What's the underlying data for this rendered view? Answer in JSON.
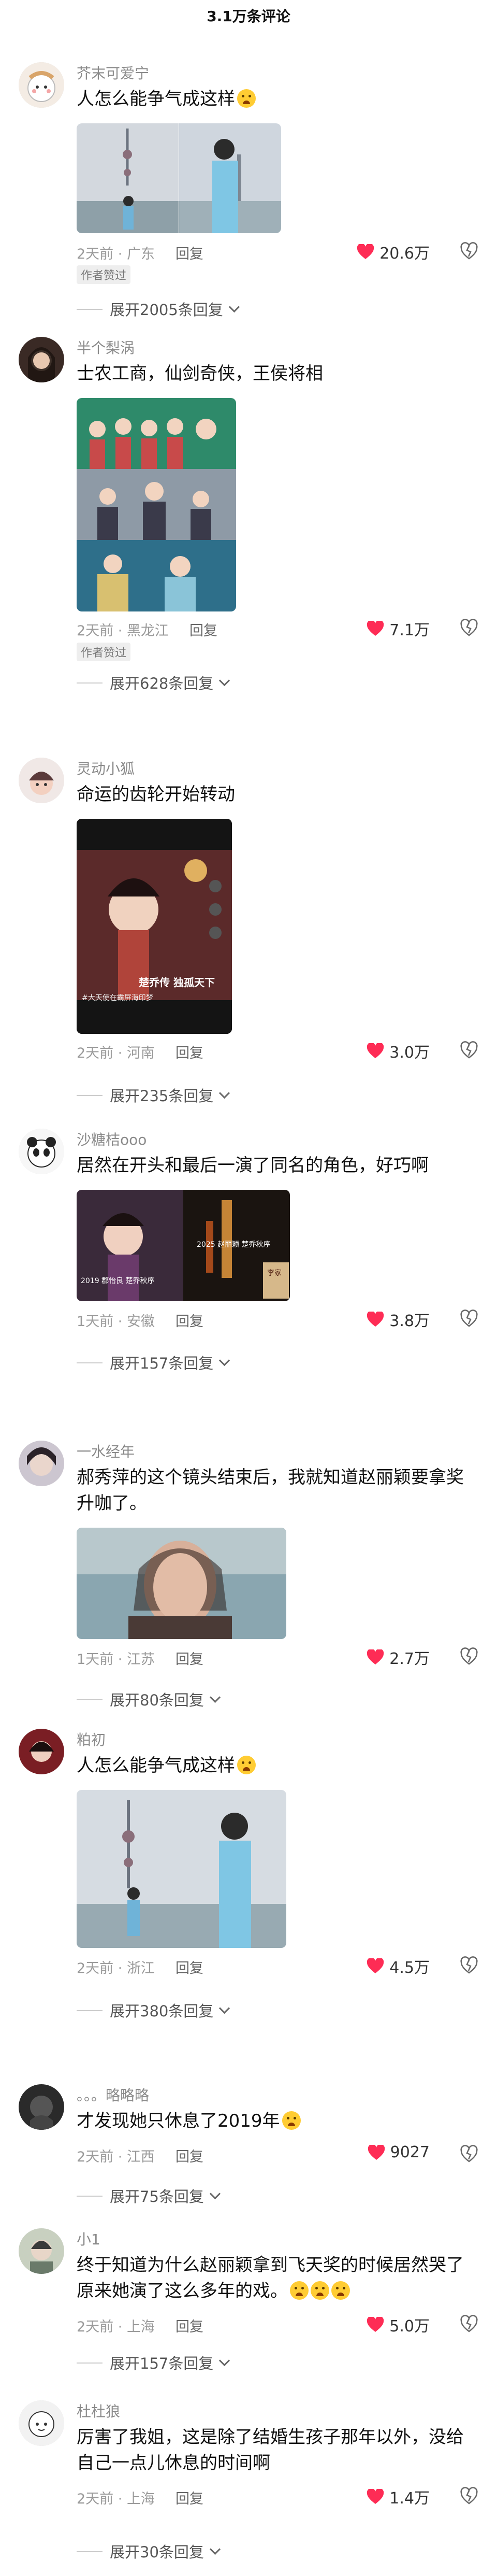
{
  "header": {
    "title": "3.1万条评论"
  },
  "comments": [
    {
      "user": "芥末可爱宁",
      "text": "人怎么能争气成这样",
      "emoji": true,
      "time": "2天前",
      "location": "广东",
      "reply": "回复",
      "likes": "20.6万",
      "badge": "作者赞过",
      "expand": "展开2005条回复"
    },
    {
      "user": "半个梨涡",
      "text": "士农工商，仙剑奇侠，王侯将相",
      "emoji": false,
      "time": "2天前",
      "location": "黑龙江",
      "reply": "回复",
      "likes": "7.1万",
      "badge": "作者赞过",
      "expand": "展开628条回复"
    },
    {
      "user": "灵动小狐",
      "text": "命运的齿轮开始转动",
      "emoji": false,
      "time": "2天前",
      "location": "河南",
      "reply": "回复",
      "likes": "3.0万",
      "badge": "",
      "expand": "展开235条回复"
    },
    {
      "user": "沙糖桔ooo",
      "text": "居然在开头和最后一演了同名的角色，好巧啊",
      "emoji": false,
      "time": "1天前",
      "location": "安徽",
      "reply": "回复",
      "likes": "3.8万",
      "badge": "",
      "expand": "展开157条回复"
    },
    {
      "user": "一水经年",
      "text": "郝秀萍的这个镜头结束后，我就知道赵丽颖要拿奖升咖了。",
      "emoji": false,
      "time": "1天前",
      "location": "江苏",
      "reply": "回复",
      "likes": "2.7万",
      "badge": "",
      "expand": "展开80条回复"
    },
    {
      "user": "粕初",
      "text": "人怎么能争气成这样",
      "emoji": true,
      "time": "2天前",
      "location": "浙江",
      "reply": "回复",
      "likes": "4.5万",
      "badge": "",
      "expand": "展开380条回复"
    },
    {
      "user": "。。。略略略",
      "text": "才发现她只休息了2019年",
      "emoji": true,
      "time": "2天前",
      "location": "江西",
      "reply": "回复",
      "likes": "9027",
      "badge": "",
      "expand": "展开75条回复"
    },
    {
      "user": "小1",
      "text": "终于知道为什么赵丽颖拿到飞天奖的时候居然哭了 原来她演了这么多年的戏。",
      "emoji": false,
      "time": "2天前",
      "location": "上海",
      "reply": "回复",
      "likes": "5.0万",
      "badge": "",
      "expand": "展开157条回复"
    },
    {
      "user": "杜杜狼",
      "text": "厉害了我姐，这是除了结婚生孩子那年以外，没给自己一点儿休息的时间啊",
      "emoji": false,
      "time": "2天前",
      "location": "上海",
      "reply": "回复",
      "likes": "1.4万",
      "badge": "",
      "expand": "展开30条回复"
    }
  ],
  "media_texts": {
    "c3_title": "楚乔传 独孤天下",
    "c3_caption": "#大天使在霸屏海印梦",
    "c4_year_left": "2019 郡怡良 楚乔秋序",
    "c4_year_right": "2025 赵丽颖 楚乔秋序",
    "c4_sign": "李家"
  },
  "colors": {
    "accent": "#fe2c55",
    "meta": "#9a9a9a"
  }
}
